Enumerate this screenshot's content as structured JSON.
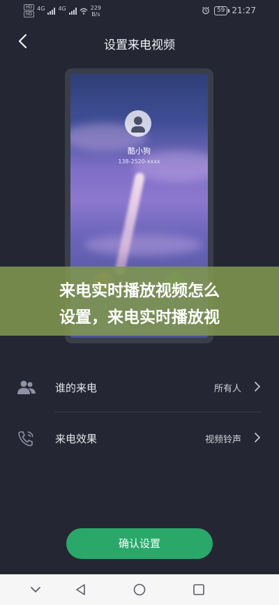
{
  "status_bar": {
    "hd_top": "HD",
    "hd_bottom": "HD",
    "network": "4G",
    "network2": "4G",
    "speed_value": "229",
    "speed_unit": "B/s",
    "battery": "59",
    "time": "21:27"
  },
  "header": {
    "title": "设置来电视频"
  },
  "preview": {
    "caller_name": "酷小狗",
    "caller_number": "138-2520-xxxx"
  },
  "banner": {
    "line1": "来电实时播放视频怎么",
    "line2": "设置，来电实时播放视"
  },
  "settings": [
    {
      "label": "谁的来电",
      "value": "所有人",
      "icon": "users-icon"
    },
    {
      "label": "来电效果",
      "value": "视频铃声",
      "icon": "phone-call-icon"
    }
  ],
  "confirm_label": "确认设置",
  "colors": {
    "background": "#242733",
    "accent_green": "#2aa86a",
    "banner": "#8096508c"
  }
}
